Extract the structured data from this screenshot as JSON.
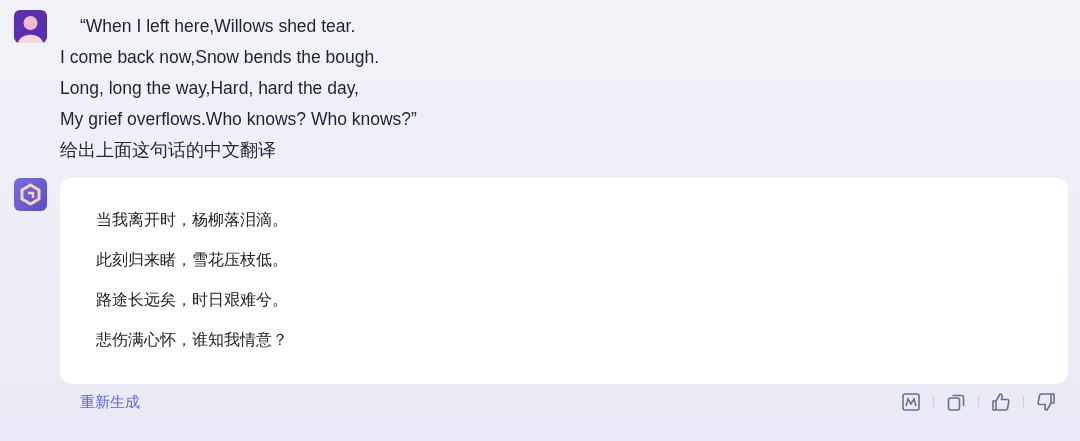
{
  "user_message": {
    "lines": [
      "“When I left here,Willows shed tear.",
      "I come back now,Snow bends the bough.",
      "Long, long the way,Hard, hard the day,",
      "My grief overflows.Who knows? Who knows?”",
      "给出上面这句话的中文翻译"
    ]
  },
  "reply": {
    "lines": [
      "当我离开时，杨柳落泪滴。",
      "此刻归来睹，雪花压枝低。",
      "路途长远矣，时日艰难兮。",
      "悲伤满心怀，谁知我情意？"
    ]
  },
  "regenerate": "重新生成",
  "actions": [
    {
      "kind": "chart"
    },
    {
      "kind": "copy"
    },
    {
      "kind": "like"
    },
    {
      "kind": "dislike"
    }
  ]
}
